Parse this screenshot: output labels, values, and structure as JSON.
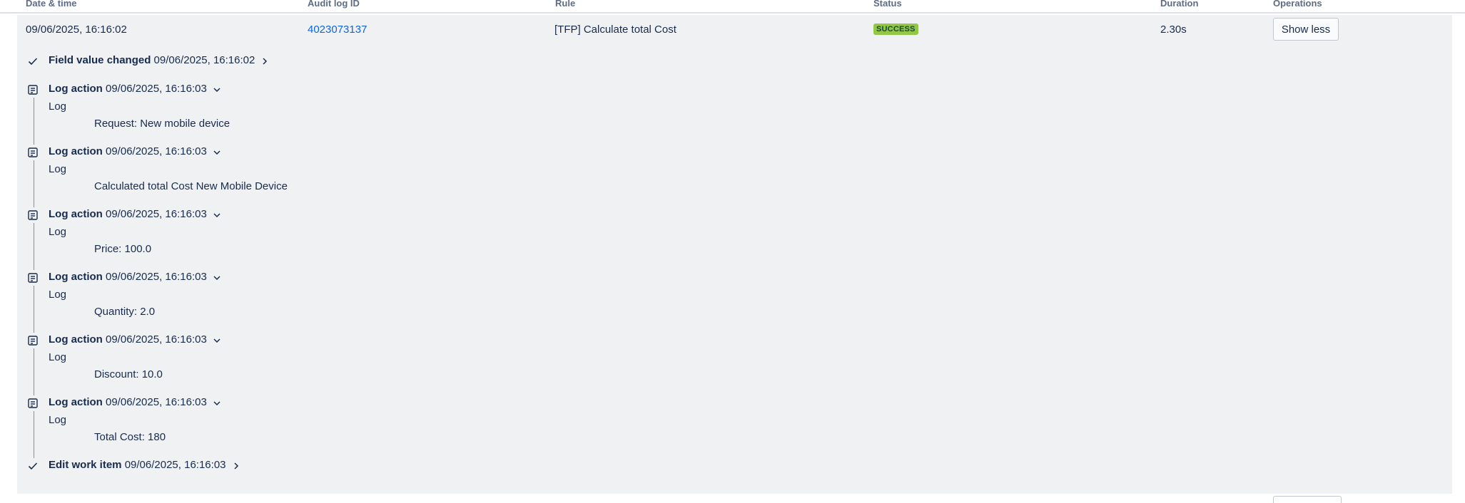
{
  "columns": {
    "date": "Date & time",
    "audit": "Audit log ID",
    "rule": "Rule",
    "status": "Status",
    "duration": "Duration",
    "operations": "Operations"
  },
  "row": {
    "date": "09/06/2025, 16:16:02",
    "audit_id": "4023073137",
    "rule": "[TFP] Calculate total Cost",
    "status": "SUCCESS",
    "duration": "2.30s",
    "operation_button": "Show less"
  },
  "colors": {
    "success_badge": "#94c748",
    "link": "#0c66e4",
    "panel_bg": "#f0f1f3"
  },
  "events": [
    {
      "icon": "check-icon",
      "title": "Field value changed",
      "time": "09/06/2025, 16:16:02",
      "chevron": "chevron-right-icon"
    },
    {
      "icon": "log-icon",
      "title": "Log action",
      "time": "09/06/2025, 16:16:03",
      "chevron": "chevron-down-icon",
      "label": "Log",
      "message": "Request: New mobile device"
    },
    {
      "icon": "log-icon",
      "title": "Log action",
      "time": "09/06/2025, 16:16:03",
      "chevron": "chevron-down-icon",
      "label": "Log",
      "message": "Calculated total Cost New Mobile Device"
    },
    {
      "icon": "log-icon",
      "title": "Log action",
      "time": "09/06/2025, 16:16:03",
      "chevron": "chevron-down-icon",
      "label": "Log",
      "message": "Price: 100.0"
    },
    {
      "icon": "log-icon",
      "title": "Log action",
      "time": "09/06/2025, 16:16:03",
      "chevron": "chevron-down-icon",
      "label": "Log",
      "message": "Quantity: 2.0"
    },
    {
      "icon": "log-icon",
      "title": "Log action",
      "time": "09/06/2025, 16:16:03",
      "chevron": "chevron-down-icon",
      "label": "Log",
      "message": "Discount: 10.0"
    },
    {
      "icon": "log-icon",
      "title": "Log action",
      "time": "09/06/2025, 16:16:03",
      "chevron": "chevron-down-icon",
      "label": "Log",
      "message": "Total Cost: 180"
    },
    {
      "icon": "check-icon",
      "title": "Edit work item",
      "time": "09/06/2025, 16:16:03",
      "chevron": "chevron-right-icon"
    }
  ]
}
